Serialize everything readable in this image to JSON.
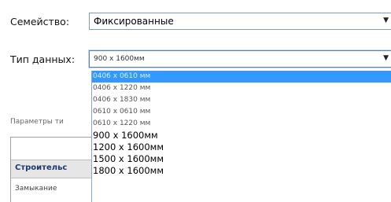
{
  "family": {
    "label": "Семейство:",
    "value": "Фиксированные"
  },
  "data_type": {
    "label": "Тип данных:",
    "value": "900 x 1600мм",
    "options": [
      {
        "label": "0406 x 0610 мм",
        "selected": true
      },
      {
        "label": "0406 x 1220 мм",
        "selected": false
      },
      {
        "label": "0406 x 1830 мм",
        "selected": false
      },
      {
        "label": "0610 x 0610 мм",
        "selected": false
      },
      {
        "label": "0610 x 1220 мм",
        "selected": false
      },
      {
        "label": "900 x 1600мм",
        "selected": false
      },
      {
        "label": "1200 x 1600мм",
        "selected": false
      },
      {
        "label": "1500 x 1600мм",
        "selected": false
      },
      {
        "label": "1800 x 1600мм",
        "selected": false
      }
    ]
  },
  "background": {
    "params_label": "Параметры ти",
    "table_header": "Строительс",
    "table_row": "Замыкание"
  },
  "colors": {
    "selection": "#3399ff",
    "border": "#7f9db9"
  }
}
